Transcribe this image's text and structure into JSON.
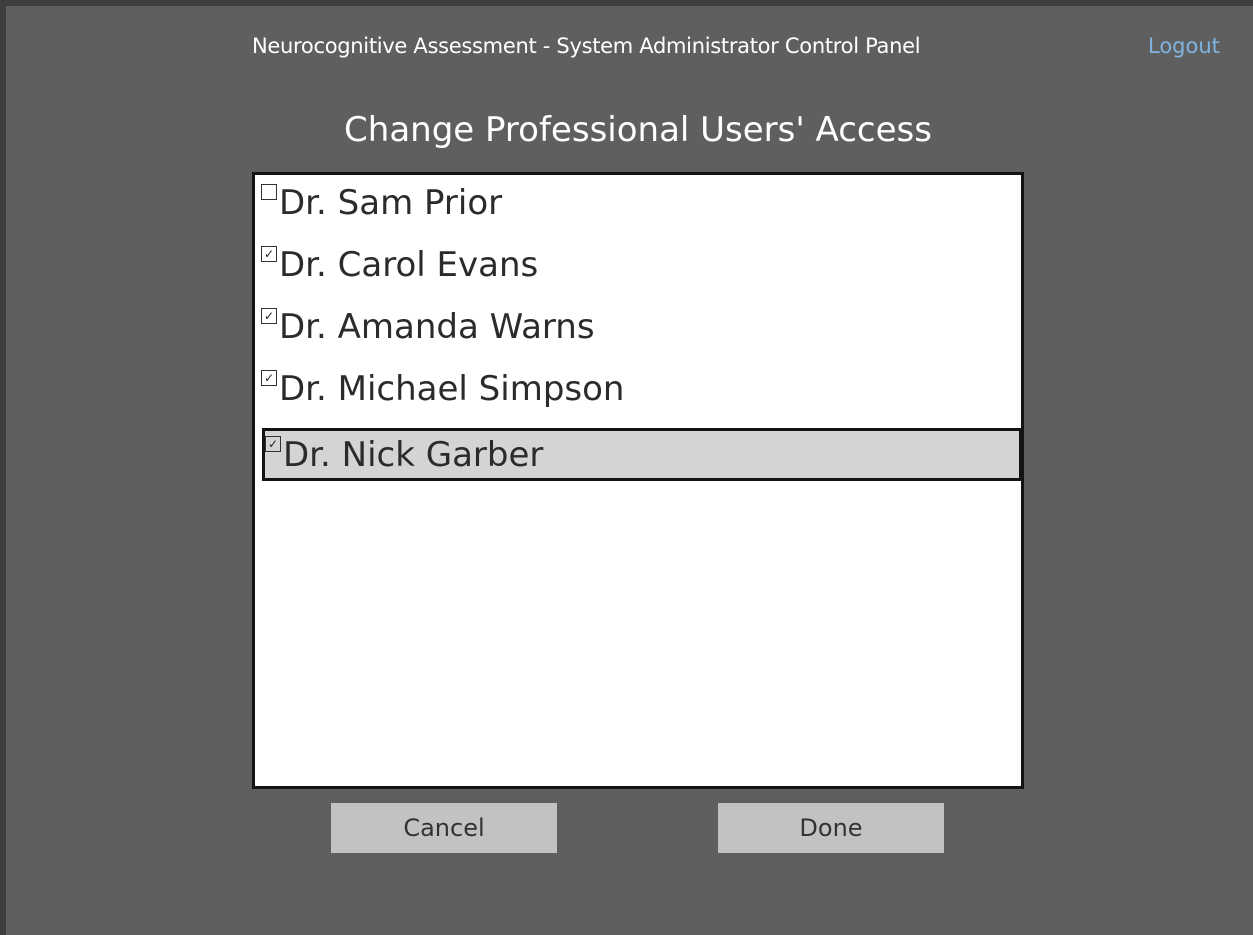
{
  "header": {
    "app_title": "Neurocognitive Assessment - System Administrator Control Panel",
    "logout_label": "Logout"
  },
  "page": {
    "title": "Change Professional Users' Access"
  },
  "users": [
    {
      "name": "Dr. Sam Prior",
      "checked": false,
      "check_glyph": ""
    },
    {
      "name": "Dr. Carol Evans",
      "checked": true,
      "check_glyph": "✓"
    },
    {
      "name": "Dr. Amanda Warns",
      "checked": true,
      "check_glyph": "✓"
    },
    {
      "name": "Dr. Michael Simpson",
      "checked": true,
      "check_glyph": "✓"
    },
    {
      "name": "Dr. Nick Garber",
      "checked": true,
      "check_glyph": "✓",
      "selected": true
    }
  ],
  "buttons": {
    "cancel_label": "Cancel",
    "done_label": "Done"
  },
  "colors": {
    "background": "#5f5f5f",
    "link": "#7fb4e0",
    "selection": "#d4d4d4",
    "button": "#c2c2c2"
  }
}
